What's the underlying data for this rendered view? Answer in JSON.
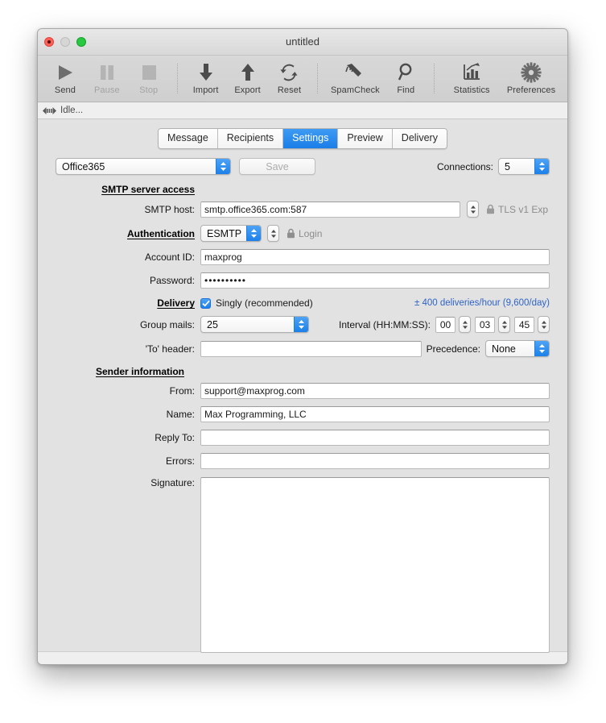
{
  "window": {
    "title": "untitled",
    "traffic_lights": [
      "close",
      "minimize",
      "zoom"
    ]
  },
  "toolbar": {
    "items": [
      {
        "label": "Send",
        "icon": "play-icon",
        "enabled": true
      },
      {
        "label": "Pause",
        "icon": "pause-icon",
        "enabled": false
      },
      {
        "label": "Stop",
        "icon": "stop-icon",
        "enabled": false
      },
      {
        "label": "Import",
        "icon": "arrow-down-icon",
        "enabled": true
      },
      {
        "label": "Export",
        "icon": "arrow-up-icon",
        "enabled": true
      },
      {
        "label": "Reset",
        "icon": "refresh-icon",
        "enabled": true
      },
      {
        "label": "SpamCheck",
        "icon": "brush-icon",
        "enabled": true
      },
      {
        "label": "Find",
        "icon": "magnifier-icon",
        "enabled": true
      },
      {
        "label": "Statistics",
        "icon": "chart-icon",
        "enabled": true
      },
      {
        "label": "Preferences",
        "icon": "gear-icon",
        "enabled": true
      }
    ]
  },
  "status": {
    "icon": "transfer-icon",
    "text": "Idle..."
  },
  "tabs": [
    {
      "label": "Message",
      "active": false
    },
    {
      "label": "Recipients",
      "active": false
    },
    {
      "label": "Settings",
      "active": true
    },
    {
      "label": "Preview",
      "active": false
    },
    {
      "label": "Delivery",
      "active": false
    }
  ],
  "settings": {
    "profile": {
      "value": "Office365"
    },
    "save_button": {
      "label": "Save",
      "enabled": false
    },
    "connections": {
      "label": "Connections:",
      "value": "5"
    },
    "smtp_section": {
      "heading": "SMTP server access"
    },
    "smtp_host": {
      "label": "SMTP host:",
      "value": "smtp.office365.com:587",
      "security_icon": "lock-icon",
      "security_text": "TLS v1 Exp"
    },
    "authentication": {
      "label": "Authentication",
      "value": "ESMTP",
      "login_icon": "lock-icon",
      "login_text": "Login"
    },
    "account_id": {
      "label": "Account ID:",
      "value": "maxprog"
    },
    "password": {
      "label": "Password:",
      "value": "••••••••••"
    },
    "delivery": {
      "label": "Delivery",
      "singly_checked": true,
      "singly_label": "Singly (recommended)",
      "rate_text": "± 400 deliveries/hour (9,600/day)"
    },
    "group_mails": {
      "label": "Group mails:",
      "value": "25"
    },
    "interval": {
      "label": "Interval (HH:MM:SS):",
      "hours": "00",
      "minutes": "03",
      "seconds": "45"
    },
    "to_header": {
      "label": "'To' header:",
      "value": ""
    },
    "precedence": {
      "label": "Precedence:",
      "value": "None"
    },
    "sender_section": {
      "heading": "Sender information"
    },
    "from": {
      "label": "From:",
      "value": "support@maxprog.com"
    },
    "name": {
      "label": "Name:",
      "value": "Max Programming, LLC"
    },
    "reply_to": {
      "label": "Reply To:",
      "value": ""
    },
    "errors": {
      "label": "Errors:",
      "value": ""
    },
    "signature": {
      "label": "Signature:",
      "value": ""
    }
  },
  "colors": {
    "accent_blue": "#1a7ee8",
    "link_blue": "#2f64c8",
    "window_bg": "#e2e2e2",
    "toolbar_bg": "#d4d4d4"
  }
}
